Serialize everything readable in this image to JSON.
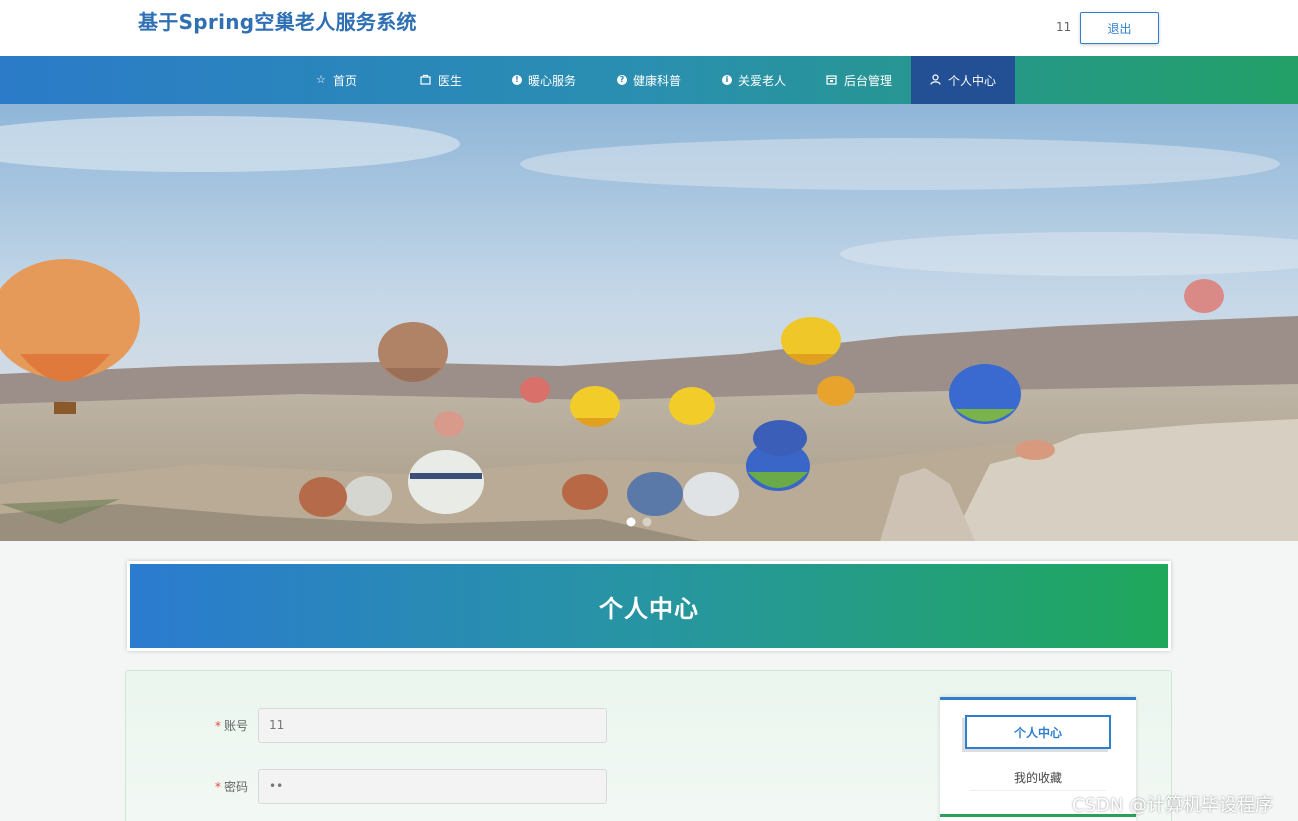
{
  "header": {
    "site_title": "基于Spring空巢老人服务系统",
    "username": "11",
    "logout_label": "退出"
  },
  "nav": {
    "items": [
      {
        "label": "首页",
        "icon": "star-icon"
      },
      {
        "label": "医生",
        "icon": "bag-icon"
      },
      {
        "label": "暖心服务",
        "icon": "info-dot-icon"
      },
      {
        "label": "健康科普",
        "icon": "question-dot-icon"
      },
      {
        "label": "关爱老人",
        "icon": "info-dot-icon"
      },
      {
        "label": "后台管理",
        "icon": "admin-box-icon"
      },
      {
        "label": "个人中心",
        "icon": "user-icon"
      }
    ],
    "active_index": 6
  },
  "banner": {
    "carousel_dots": 2,
    "active_dot": 0
  },
  "section": {
    "title": "个人中心"
  },
  "form": {
    "fields": [
      {
        "label": "账号",
        "value": "11",
        "required": true
      },
      {
        "label": "密码",
        "value": "••",
        "required": true
      }
    ]
  },
  "side_menu": {
    "items": [
      "个人中心",
      "我的收藏"
    ],
    "active_index": 0
  },
  "watermark": "CSDN @计算机毕设程序",
  "colors": {
    "brand_blue": "#2f7fd0",
    "brand_green": "#22a067",
    "nav_active": "#234f94"
  }
}
